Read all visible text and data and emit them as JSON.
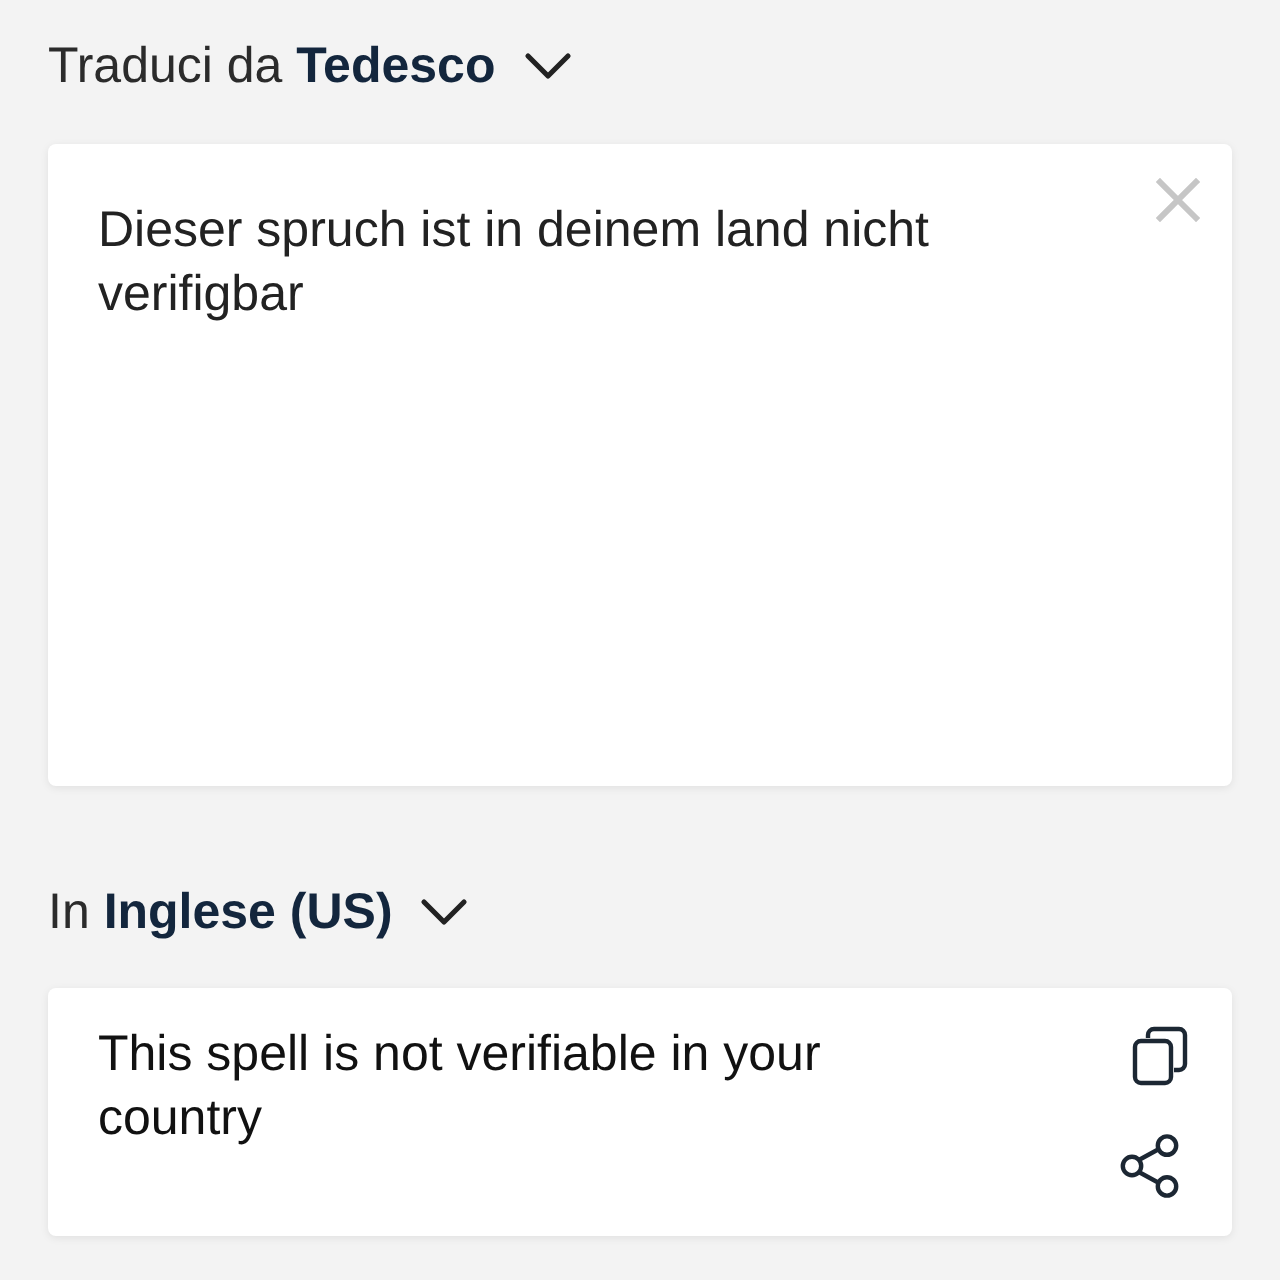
{
  "source_language": {
    "prefix": "Traduci da",
    "language": "Tedesco"
  },
  "source_text": {
    "value": "Dieser spruch ist in deinem land nicht verifigbar"
  },
  "target_language": {
    "prefix": "In",
    "language": "Inglese (US)"
  },
  "translation": {
    "text": "This spell is not verifiable in your country"
  }
}
